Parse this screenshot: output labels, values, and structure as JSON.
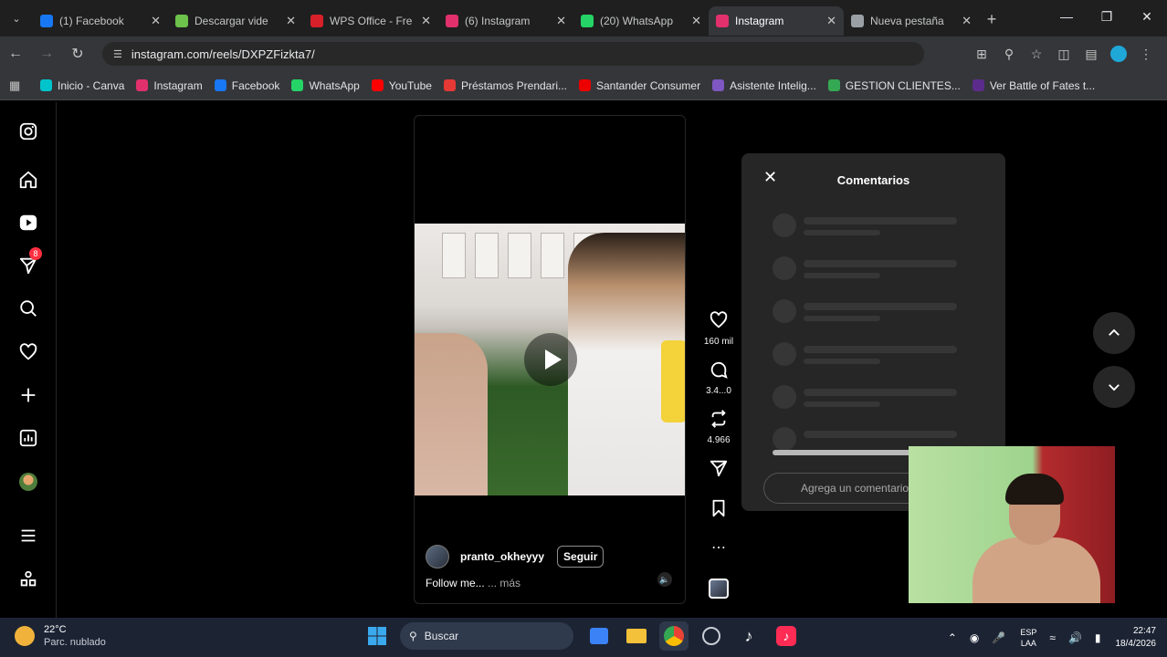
{
  "browser": {
    "tabs": [
      {
        "title": "(1) Facebook",
        "icon": "facebook-icon",
        "color": "#1877f2",
        "active": false
      },
      {
        "title": "Descargar vide",
        "icon": "download-icon",
        "color": "#6cc24a",
        "active": false
      },
      {
        "title": "WPS Office - Fre",
        "icon": "wps-icon",
        "color": "#d8202a",
        "active": false
      },
      {
        "title": "(6) Instagram",
        "icon": "instagram-icon",
        "color": "#e1306c",
        "active": false
      },
      {
        "title": "(20) WhatsApp",
        "icon": "whatsapp-icon",
        "color": "#25d366",
        "active": false
      },
      {
        "title": "Instagram",
        "icon": "instagram-icon",
        "color": "#e1306c",
        "active": true
      },
      {
        "title": "Nueva pestaña",
        "icon": "chrome-icon",
        "color": "#9aa0a6",
        "active": false
      }
    ],
    "url": "instagram.com/reels/DXPZFizkta7/",
    "bookmarks": [
      {
        "label": "Inicio - Canva",
        "color": "#00c4cc"
      },
      {
        "label": "Instagram",
        "color": "#e1306c"
      },
      {
        "label": "Facebook",
        "color": "#1877f2"
      },
      {
        "label": "WhatsApp",
        "color": "#25d366"
      },
      {
        "label": "YouTube",
        "color": "#ff0000"
      },
      {
        "label": "Préstamos Prendari...",
        "color": "#e53935"
      },
      {
        "label": "Santander Consumer",
        "color": "#ec0000"
      },
      {
        "label": "Asistente Intelig...",
        "color": "#7e57c2"
      },
      {
        "label": "GESTION CLIENTES...",
        "color": "#34a853"
      },
      {
        "label": "Ver Battle of Fates t...",
        "color": "#5b2c8c"
      }
    ]
  },
  "sidebar": {
    "items": [
      {
        "name": "instagram-logo-icon"
      },
      {
        "name": "home-icon"
      },
      {
        "name": "reels-icon"
      },
      {
        "name": "messages-icon",
        "badge": "8"
      },
      {
        "name": "search-icon"
      },
      {
        "name": "notifications-icon"
      },
      {
        "name": "create-icon"
      },
      {
        "name": "dashboard-icon"
      },
      {
        "name": "profile-avatar"
      },
      {
        "name": "menu-icon"
      },
      {
        "name": "meta-apps-icon"
      }
    ]
  },
  "reel": {
    "username": "pranto_okheyyy",
    "follow_label": "Seguir",
    "caption": "Follow me...",
    "more": "... más",
    "likes": "160 mil",
    "comments": "3.4...0",
    "reposts": "4.966"
  },
  "comments_panel": {
    "title": "Comentarios",
    "input_placeholder": "Agrega un comentario"
  },
  "taskbar": {
    "temp": "22°C",
    "weather": "Parc. nublado",
    "search_placeholder": "Buscar",
    "lang_1": "ESP",
    "lang_2": "LAA",
    "time": "22:47",
    "date": "18/4/2026"
  }
}
